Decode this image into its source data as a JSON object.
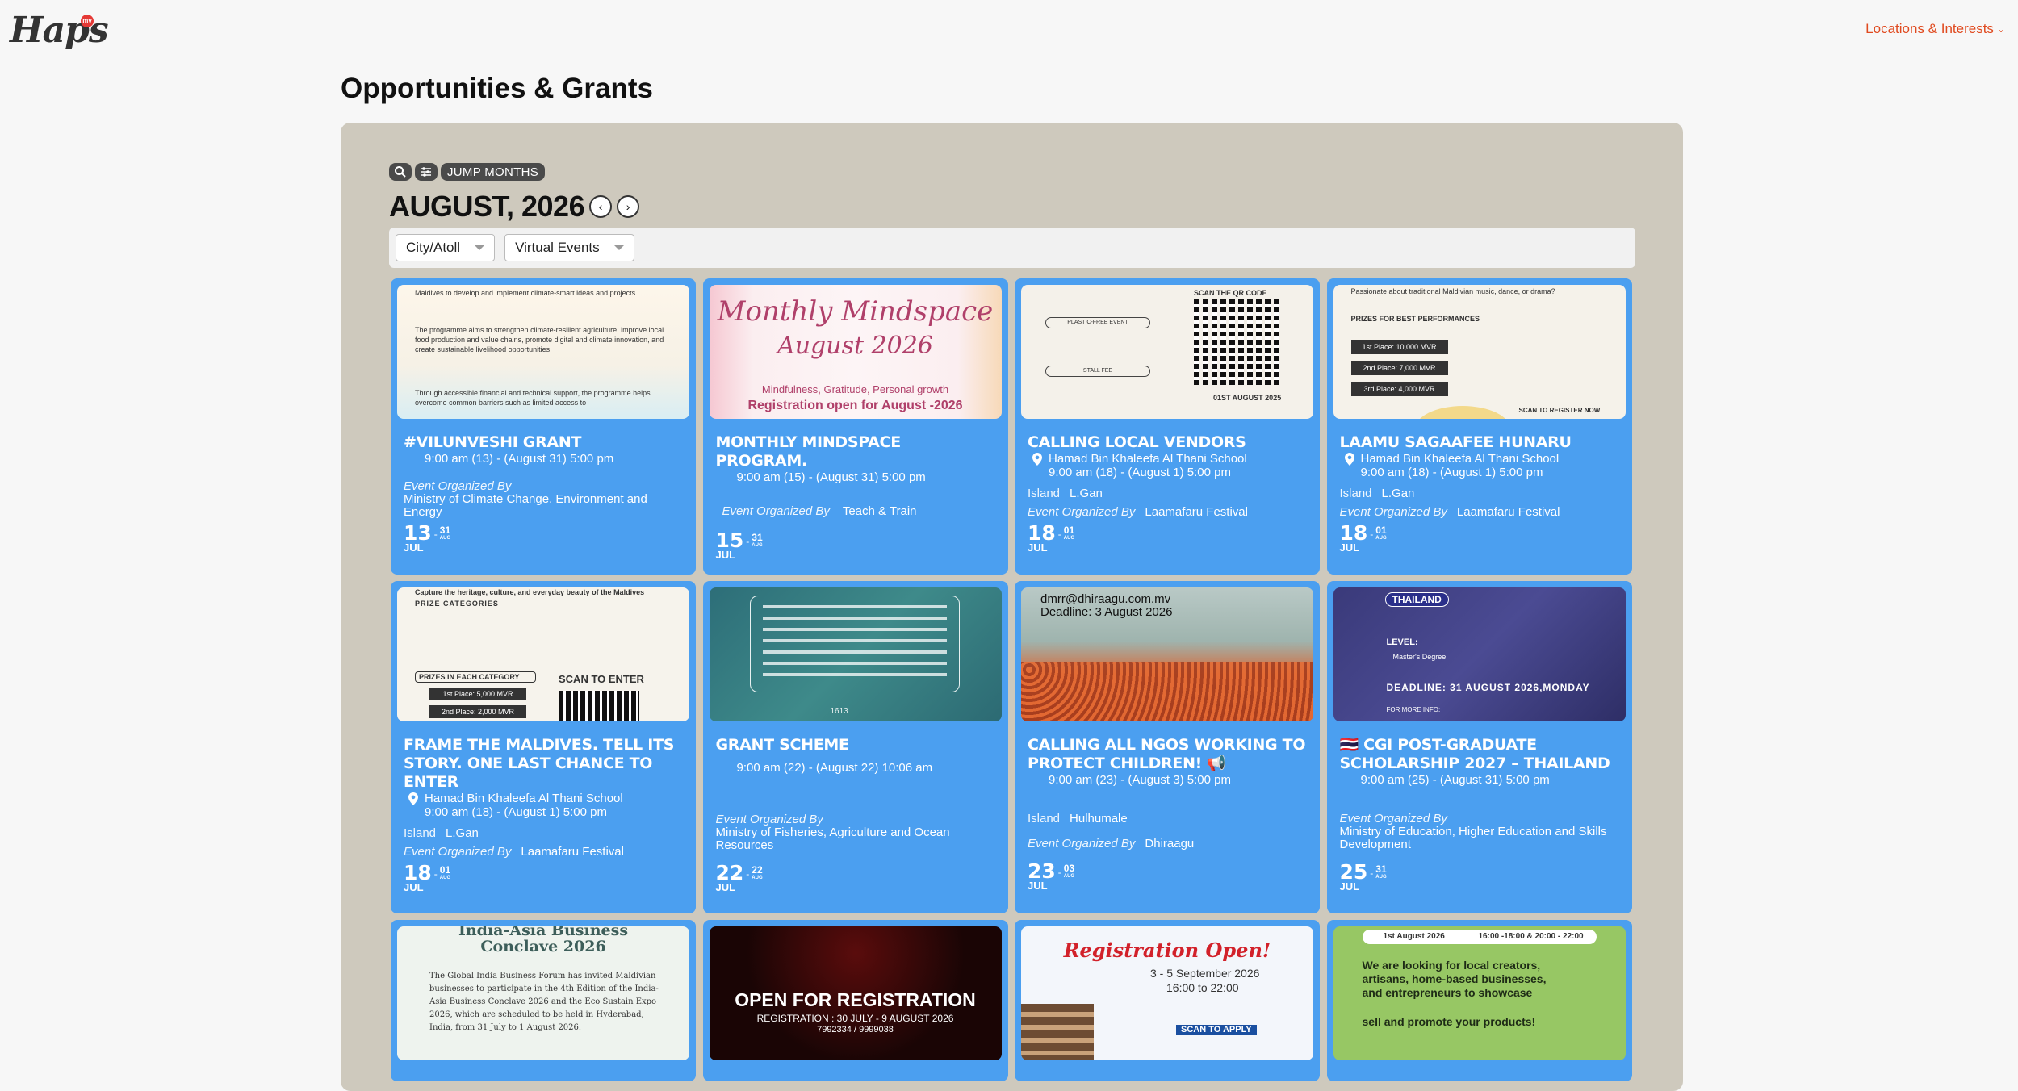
{
  "header": {
    "logo": "Haps",
    "logo_badge": "mv",
    "locations_menu": "Locations & Interests"
  },
  "page_title": "Opportunities & Grants",
  "toolbar": {
    "search_icon": "search-icon",
    "filter_icon": "sliders-icon",
    "jump_months": "JUMP MONTHS"
  },
  "calendar": {
    "month_title": "AUGUST, 2026",
    "prev_icon": "chevron-left-icon",
    "next_icon": "chevron-right-icon"
  },
  "filters": {
    "city": "City/Atoll",
    "virtual": "Virtual Events"
  },
  "labels": {
    "organized_by": "Event Organized By",
    "island": "Island"
  },
  "events": [
    {
      "title": "#VILUNVESHI GRANT",
      "location": "",
      "time": "9:00 am (13) - (August 31) 5:00 pm",
      "island": "",
      "organizer": "Ministry of Climate Change, Environment and Energy",
      "start_day": "13",
      "start_mon": "JUL",
      "end_day": "31",
      "end_mon": "AUG",
      "thumb_text": [
        "Maldives to develop and implement climate-smart ideas and projects.",
        "The programme aims to strengthen climate-resilient agriculture, improve local food production and value chains, promote digital and climate innovation, and create sustainable livelihood opportunities",
        "Through accessible financial and technical support, the programme helps overcome common barriers such as limited access to"
      ]
    },
    {
      "title": "MONTHLY MINDSPACE PROGRAM.",
      "location": "",
      "time": "9:00 am (15) - (August 31) 5:00 pm",
      "island": "",
      "organizer": "Teach & Train",
      "start_day": "15",
      "start_mon": "JUL",
      "end_day": "31",
      "end_mon": "AUG",
      "thumb_text": [
        "Monthly Mindspace",
        "August 2026",
        "Mindfulness, Gratitude, Personal growth",
        "Registration open for August -2026"
      ]
    },
    {
      "title": "CALLING LOCAL VENDORS",
      "location": "Hamad Bin Khaleefa Al Thani School",
      "time": "9:00 am (18) - (August 1) 5:00 pm",
      "island": "L.Gan",
      "organizer": "Laamafaru Festival",
      "start_day": "18",
      "start_mon": "JUL",
      "end_day": "01",
      "end_mon": "AUG",
      "thumb_text": [
        "SCAN THE QR CODE",
        "PLASTIC-FREE EVENT",
        "STALL FEE",
        "01ST AUGUST 2025"
      ]
    },
    {
      "title": "LAAMU SAGAAFEE HUNARU",
      "location": "Hamad Bin Khaleefa Al Thani School",
      "time": "9:00 am (18) - (August 1) 5:00 pm",
      "island": "L.Gan",
      "organizer": "Laamafaru Festival",
      "start_day": "18",
      "start_mon": "JUL",
      "end_day": "01",
      "end_mon": "AUG",
      "thumb_text": [
        "Passionate about traditional Maldivian music, dance, or drama?",
        "PRIZES FOR BEST PERFORMANCES",
        "1st Place: 10,000 MVR",
        "2nd Place: 7,000 MVR",
        "3rd Place: 4,000 MVR",
        "SCAN TO REGISTER NOW"
      ]
    },
    {
      "title": "FRAME THE MALDIVES. TELL ITS STORY. ONE LAST CHANCE TO ENTER",
      "location": "Hamad Bin Khaleefa Al Thani School",
      "time": "9:00 am (18) - (August 1) 5:00 pm",
      "island": "L.Gan",
      "organizer": "Laamafaru Festival",
      "start_day": "18",
      "start_mon": "JUL",
      "end_day": "01",
      "end_mon": "AUG",
      "thumb_text": [
        "Capture the heritage, culture, and everyday beauty of the Maldives",
        "PRIZE CATEGORIES",
        "PRIZES IN EACH CATEGORY",
        "SCAN TO ENTER",
        "1st Place: 5,000 MVR",
        "2nd Place: 2,000 MVR"
      ]
    },
    {
      "title": "GRANT SCHEME",
      "location": "",
      "time": "9:00 am (22) - (August 22) 10:06 am",
      "island": "",
      "organizer": "Ministry of Fisheries, Agriculture and Ocean Resources",
      "start_day": "22",
      "start_mon": "JUL",
      "end_day": "22",
      "end_mon": "AUG",
      "thumb_text": [
        "1613"
      ]
    },
    {
      "title": "CALLING ALL NGOS WORKING TO PROTECT CHILDREN! 📢",
      "location": "",
      "time": "9:00 am (23) - (August 3) 5:00 pm",
      "island": "Hulhumale",
      "organizer": "Dhiraagu",
      "start_day": "23",
      "start_mon": "JUL",
      "end_day": "03",
      "end_mon": "AUG",
      "thumb_text": [
        "dmrr@dhiraagu.com.mv",
        "Deadline: 3 August 2026"
      ]
    },
    {
      "title": "🇹🇭 CGI POST-GRADUATE SCHOLARSHIP 2027 – THAILAND",
      "location": "",
      "time": "9:00 am (25) - (August 31) 5:00 pm",
      "island": "",
      "organizer": "Ministry of Education, Higher Education and Skills Development",
      "start_day": "25",
      "start_mon": "JUL",
      "end_day": "31",
      "end_mon": "AUG",
      "thumb_text": [
        "THAILAND",
        "LEVEL:",
        "Master's Degree",
        "DEADLINE: 31 AUGUST 2026,MONDAY",
        "FOR MORE INFO:"
      ]
    }
  ],
  "row3": [
    {
      "thumb_text": [
        "India-Asia Business",
        "Conclave 2026",
        "The Global India Business Forum has invited Maldivian businesses to participate in the 4th Edition of the India-Asia Business Conclave 2026 and the Eco Sustain Expo 2026, which are scheduled to be held in Hyderabad, India, from 31 July to 1 August 2026."
      ]
    },
    {
      "thumb_text": [
        "OPEN FOR REGISTRATION",
        "REGISTRATION : 30 JULY - 9 AUGUST 2026",
        "7992334 / 9999038"
      ]
    },
    {
      "thumb_text": [
        "Registration Open!",
        "3 - 5 September 2026",
        "16:00 to 22:00",
        "SCAN TO APPLY"
      ]
    },
    {
      "thumb_text": [
        "1st August 2026",
        "16:00 -18:00 & 20:00 - 22:00",
        "We are looking for local creators, artisans, home-based businesses, and entrepreneurs to showcase",
        "sell and promote your products!"
      ]
    }
  ],
  "colors": {
    "card": "#4b9ff0",
    "panel": "#cec9bd",
    "accent": "#e04a1f"
  }
}
